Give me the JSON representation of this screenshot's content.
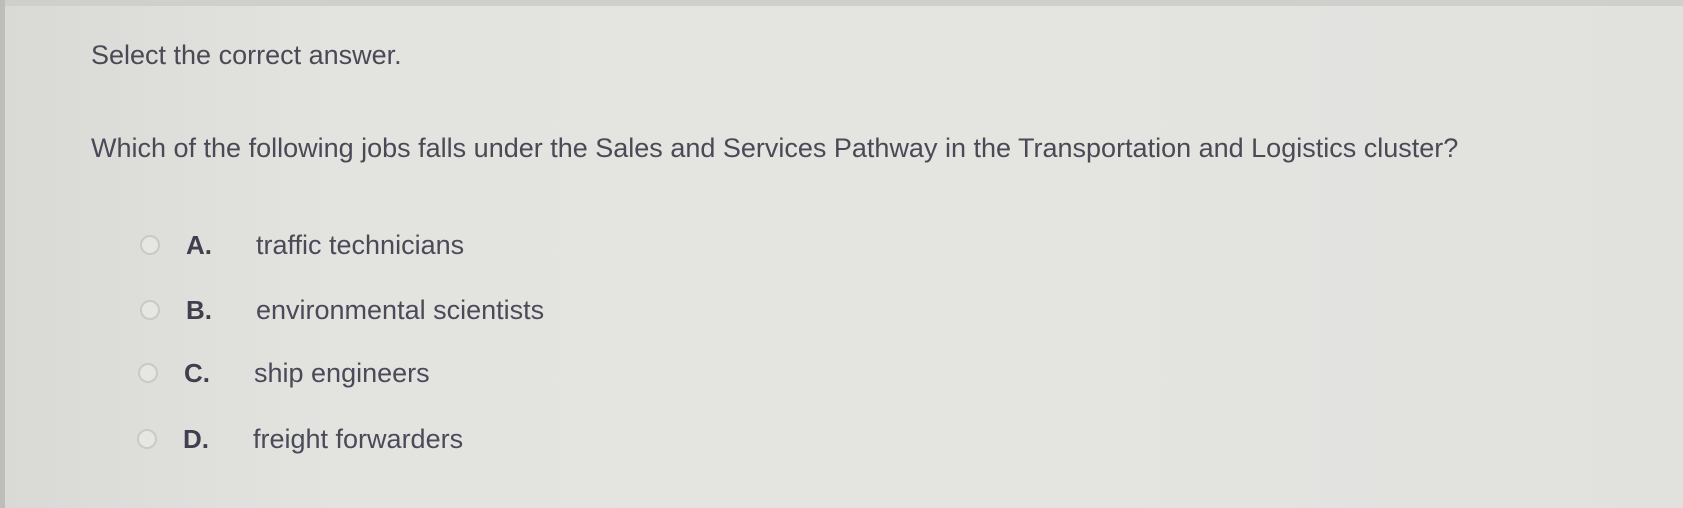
{
  "instruction": "Select the correct answer.",
  "question": "Which of the following jobs falls under the Sales and Services Pathway in the Transportation and Logistics cluster?",
  "options": [
    {
      "letter": "A.",
      "text": "traffic technicians",
      "selected": false
    },
    {
      "letter": "B.",
      "text": "environmental scientists",
      "selected": false
    },
    {
      "letter": "C.",
      "text": "ship engineers",
      "selected": false
    },
    {
      "letter": "D.",
      "text": "freight forwarders",
      "selected": false
    }
  ]
}
